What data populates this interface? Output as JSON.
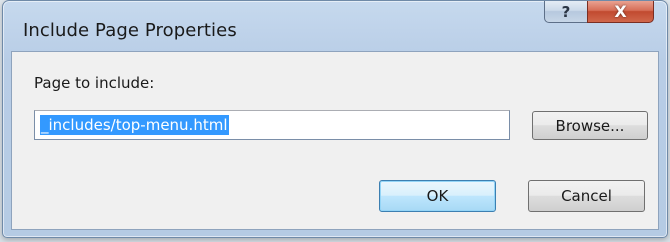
{
  "window": {
    "title": "Include Page Properties",
    "help_button_glyph": "?",
    "close_button_glyph": "X"
  },
  "form": {
    "prompt_label": "Page to include:",
    "page_path_value": "_includes/top-menu.html",
    "browse_label": "Browse...",
    "ok_label": "OK",
    "cancel_label": "Cancel"
  },
  "icons": {
    "help": "help-icon",
    "close": "close-icon"
  },
  "colors": {
    "selection_highlight": "#3399ff",
    "close_button": "#c14a30",
    "titlebar": "#bfd3ea",
    "default_button_border": "#3c7fb1"
  }
}
